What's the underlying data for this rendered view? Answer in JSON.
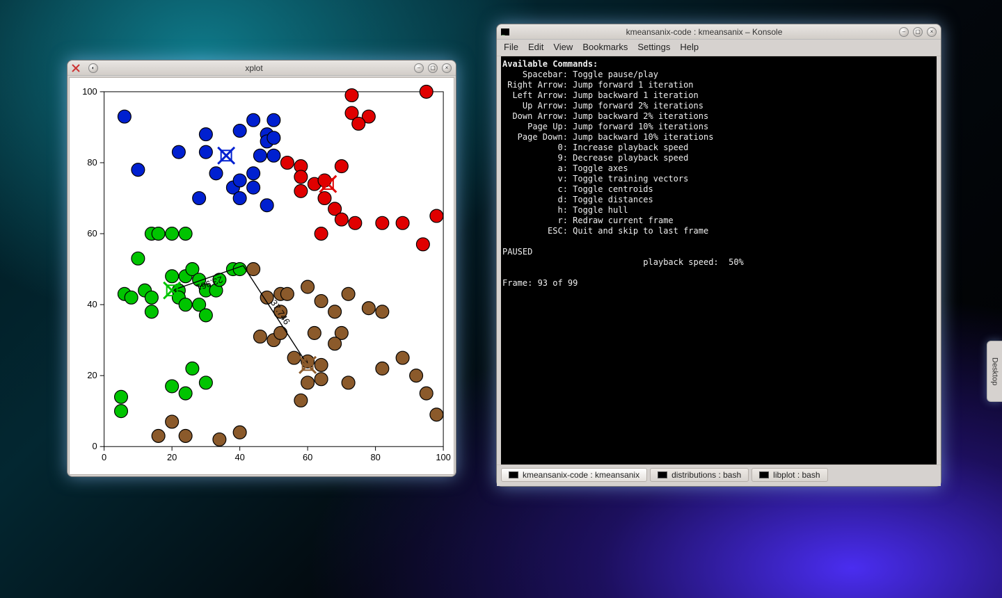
{
  "desktop_tab": "Desktop",
  "xplot": {
    "title": "xplot",
    "distances": [
      {
        "label": "23.961"
      },
      {
        "label": "37.746"
      }
    ],
    "chart_data": {
      "type": "scatter",
      "xlim": [
        0,
        100
      ],
      "ylim": [
        0,
        100
      ],
      "xticks": [
        0,
        20,
        40,
        60,
        80,
        100
      ],
      "yticks": [
        0,
        20,
        40,
        60,
        80,
        100
      ],
      "clusters": [
        {
          "name": "blue",
          "color": "#0020d0",
          "centroid": [
            36,
            82
          ],
          "points": [
            [
              6,
              93
            ],
            [
              30,
              88
            ],
            [
              30,
              83
            ],
            [
              40,
              89
            ],
            [
              44,
              92
            ],
            [
              46,
              82
            ],
            [
              48,
              88
            ],
            [
              48,
              86
            ],
            [
              50,
              92
            ],
            [
              50,
              87
            ],
            [
              50,
              82
            ],
            [
              22,
              83
            ],
            [
              10,
              78
            ],
            [
              33,
              77
            ],
            [
              28,
              70
            ],
            [
              38,
              73
            ],
            [
              40,
              75
            ],
            [
              40,
              70
            ],
            [
              44,
              77
            ],
            [
              44,
              73
            ],
            [
              48,
              68
            ]
          ]
        },
        {
          "name": "red",
          "color": "#e00000",
          "centroid": [
            66,
            74
          ],
          "points": [
            [
              95,
              100
            ],
            [
              73,
              99
            ],
            [
              73,
              94
            ],
            [
              78,
              93
            ],
            [
              75,
              91
            ],
            [
              54,
              80
            ],
            [
              58,
              79
            ],
            [
              58,
              76
            ],
            [
              58,
              72
            ],
            [
              62,
              74
            ],
            [
              65,
              75
            ],
            [
              65,
              70
            ],
            [
              68,
              67
            ],
            [
              70,
              79
            ],
            [
              70,
              64
            ],
            [
              74,
              63
            ],
            [
              82,
              63
            ],
            [
              88,
              63
            ],
            [
              94,
              57
            ],
            [
              98,
              65
            ],
            [
              64,
              60
            ]
          ]
        },
        {
          "name": "green",
          "color": "#00c400",
          "centroid": [
            20,
            44
          ],
          "points": [
            [
              5,
              14
            ],
            [
              5,
              10
            ],
            [
              14,
              60
            ],
            [
              16,
              60
            ],
            [
              20,
              60
            ],
            [
              24,
              60
            ],
            [
              10,
              53
            ],
            [
              6,
              43
            ],
            [
              8,
              42
            ],
            [
              12,
              44
            ],
            [
              14,
              42
            ],
            [
              14,
              38
            ],
            [
              20,
              48
            ],
            [
              24,
              48
            ],
            [
              26,
              50
            ],
            [
              28,
              47
            ],
            [
              22,
              44
            ],
            [
              22,
              42
            ],
            [
              24,
              40
            ],
            [
              28,
              40
            ],
            [
              30,
              44
            ],
            [
              30,
              37
            ],
            [
              33,
              44
            ],
            [
              34,
              47
            ],
            [
              38,
              50
            ],
            [
              40,
              50
            ],
            [
              20,
              17
            ],
            [
              24,
              15
            ],
            [
              26,
              22
            ],
            [
              30,
              18
            ]
          ]
        },
        {
          "name": "brown",
          "color": "#8b5a2b",
          "centroid": [
            60,
            23
          ],
          "points": [
            [
              16,
              3
            ],
            [
              24,
              3
            ],
            [
              34,
              2
            ],
            [
              20,
              7
            ],
            [
              40,
              4
            ],
            [
              44,
              50
            ],
            [
              48,
              42
            ],
            [
              52,
              43
            ],
            [
              52,
              38
            ],
            [
              54,
              43
            ],
            [
              60,
              45
            ],
            [
              64,
              41
            ],
            [
              68,
              38
            ],
            [
              72,
              43
            ],
            [
              78,
              39
            ],
            [
              82,
              38
            ],
            [
              46,
              31
            ],
            [
              50,
              30
            ],
            [
              52,
              32
            ],
            [
              62,
              32
            ],
            [
              70,
              32
            ],
            [
              56,
              25
            ],
            [
              60,
              24
            ],
            [
              64,
              23
            ],
            [
              68,
              29
            ],
            [
              60,
              18
            ],
            [
              64,
              19
            ],
            [
              88,
              25
            ],
            [
              92,
              20
            ],
            [
              95,
              15
            ],
            [
              98,
              9
            ],
            [
              58,
              13
            ],
            [
              72,
              18
            ],
            [
              82,
              22
            ]
          ]
        }
      ],
      "annotations": [
        {
          "from": [
            41,
            51
          ],
          "to": [
            20,
            44
          ],
          "label": "23.961"
        },
        {
          "from": [
            41,
            51
          ],
          "to": [
            60,
            23
          ],
          "label": "37.746"
        }
      ]
    }
  },
  "konsole": {
    "title": "kmeansanix-code : kmeansanix – Konsole",
    "menu": [
      "File",
      "Edit",
      "View",
      "Bookmarks",
      "Settings",
      "Help"
    ],
    "tabs": [
      {
        "label": "kmeansanix-code : kmeansanix",
        "active": true
      },
      {
        "label": "distributions : bash",
        "active": false
      },
      {
        "label": "libplot : bash",
        "active": false
      }
    ],
    "commands_heading": "Available Commands:",
    "commands": [
      {
        "key": "Spacebar",
        "desc": "Toggle pause/play"
      },
      {
        "key": "Right Arrow",
        "desc": "Jump forward 1 iteration"
      },
      {
        "key": "Left Arrow",
        "desc": "Jump backward 1 iteration"
      },
      {
        "key": "Up Arrow",
        "desc": "Jump forward 2% iterations"
      },
      {
        "key": "Down Arrow",
        "desc": "Jump backward 2% iterations"
      },
      {
        "key": "Page Up",
        "desc": "Jump forward 10% iterations"
      },
      {
        "key": "Page Down",
        "desc": "Jump backward 10% iterations"
      },
      {
        "key": "0",
        "desc": "Increase playback speed"
      },
      {
        "key": "9",
        "desc": "Decrease playback speed"
      },
      {
        "key": "a",
        "desc": "Toggle axes"
      },
      {
        "key": "v",
        "desc": "Toggle training vectors"
      },
      {
        "key": "c",
        "desc": "Toggle centroids"
      },
      {
        "key": "d",
        "desc": "Toggle distances"
      },
      {
        "key": "h",
        "desc": "Toggle hull"
      },
      {
        "key": "r",
        "desc": "Redraw current frame"
      },
      {
        "key": "ESC",
        "desc": "Quit and skip to last frame"
      }
    ],
    "status_paused": "PAUSED",
    "playback_label": "playback speed:",
    "playback_value": "50%",
    "frame_line": "Frame: 93 of 99"
  }
}
